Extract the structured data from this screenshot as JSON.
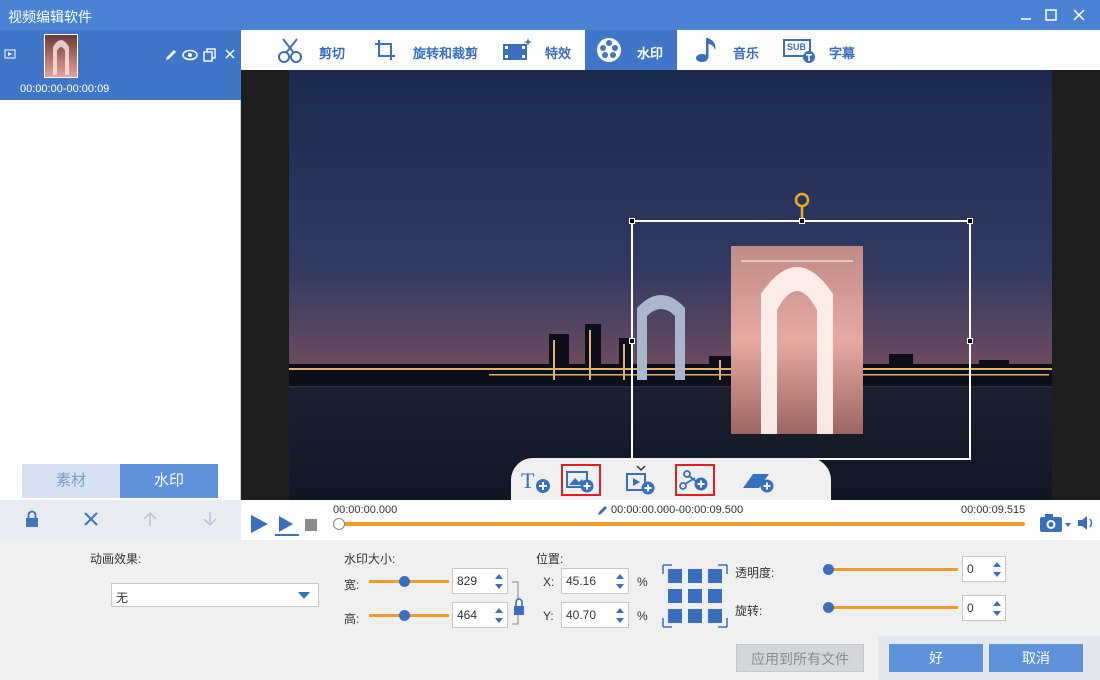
{
  "window": {
    "title": "视频编辑软件"
  },
  "clip": {
    "time_range": "00:00:00-00:00:09"
  },
  "left_tabs": [
    {
      "label": "素材"
    },
    {
      "label": "水印"
    }
  ],
  "tabs": [
    {
      "label": "剪切",
      "icon": "scissors-icon"
    },
    {
      "label": "旋转和裁剪",
      "icon": "crop-rotate-icon"
    },
    {
      "label": "特效",
      "icon": "effects-icon"
    },
    {
      "label": "水印",
      "icon": "watermark-icon"
    },
    {
      "label": "音乐",
      "icon": "music-icon"
    },
    {
      "label": "字幕",
      "icon": "subtitle-icon"
    }
  ],
  "subtitle_badge": "SUB",
  "timeline": {
    "start": "00:00:00.000",
    "range": "00:00:00.000-00:00:09.500",
    "end": "00:00:09.515",
    "progress": 0.0
  },
  "params": {
    "animation_label": "动画效果:",
    "animation_value": "无",
    "size_label": "水印大小:",
    "width_label": "宽:",
    "width_value": "829",
    "height_label": "高:",
    "height_value": "464",
    "position_label": "位置:",
    "x_label": "X:",
    "x_value": "45.16",
    "y_label": "Y:",
    "y_value": "40.70",
    "percent": "%",
    "opacity_label": "透明度:",
    "opacity_value": "0",
    "rotation_label": "旋转:",
    "rotation_value": "0",
    "apply_all": "应用到所有文件",
    "ok": "好",
    "cancel": "取消"
  },
  "colors": {
    "accent": "#3f76c8",
    "title_bar": "#4a82d4",
    "slider": "#f29a2a",
    "highlight": "#e02020"
  }
}
